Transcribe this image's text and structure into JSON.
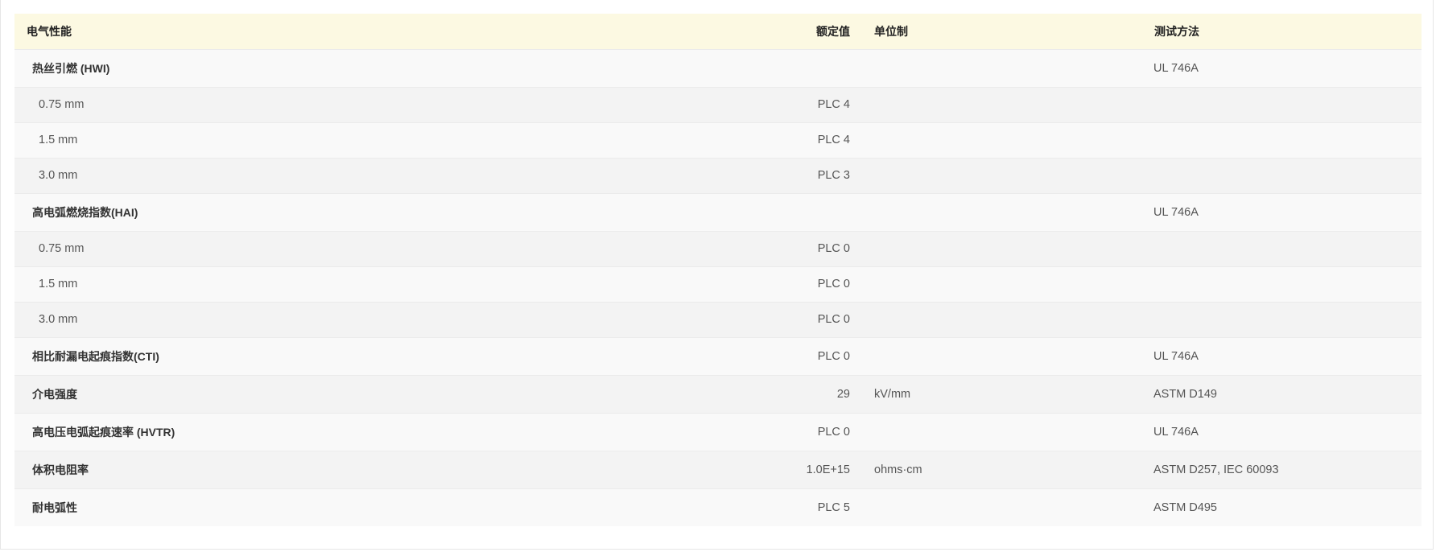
{
  "headers": {
    "property": "电气性能",
    "value": "额定值",
    "unit": "单位制",
    "method": "测试方法"
  },
  "rows": [
    {
      "property": "热丝引燃 (HWI)",
      "value": "",
      "unit": "",
      "method": "UL 746A"
    },
    {
      "property": "0.75 mm",
      "value": "PLC 4",
      "unit": "",
      "method": ""
    },
    {
      "property": "1.5 mm",
      "value": "PLC 4",
      "unit": "",
      "method": ""
    },
    {
      "property": "3.0 mm",
      "value": "PLC 3",
      "unit": "",
      "method": ""
    },
    {
      "property": "高电弧燃烧指数(HAI)",
      "value": "",
      "unit": "",
      "method": "UL 746A"
    },
    {
      "property": "0.75 mm",
      "value": "PLC 0",
      "unit": "",
      "method": ""
    },
    {
      "property": "1.5 mm",
      "value": "PLC 0",
      "unit": "",
      "method": ""
    },
    {
      "property": "3.0 mm",
      "value": "PLC 0",
      "unit": "",
      "method": ""
    },
    {
      "property": "相比耐漏电起痕指数(CTI)",
      "value": "PLC 0",
      "unit": "",
      "method": "UL 746A"
    },
    {
      "property": "介电强度",
      "value": "29",
      "unit": "kV/mm",
      "method": "ASTM D149"
    },
    {
      "property": "高电压电弧起痕速率 (HVTR)",
      "value": "PLC 0",
      "unit": "",
      "method": "UL 746A"
    },
    {
      "property": "体积电阻率",
      "value": "1.0E+15",
      "unit": "ohms·cm",
      "method": "ASTM D257, IEC 60093"
    },
    {
      "property": "耐电弧性",
      "value": "PLC 5",
      "unit": "",
      "method": "ASTM D495"
    }
  ],
  "colors": {
    "header_bg": "#fcf9e2",
    "row_odd_bg": "#f9f9f9",
    "row_even_bg": "#f3f3f3",
    "divider": "#ebebeb"
  }
}
